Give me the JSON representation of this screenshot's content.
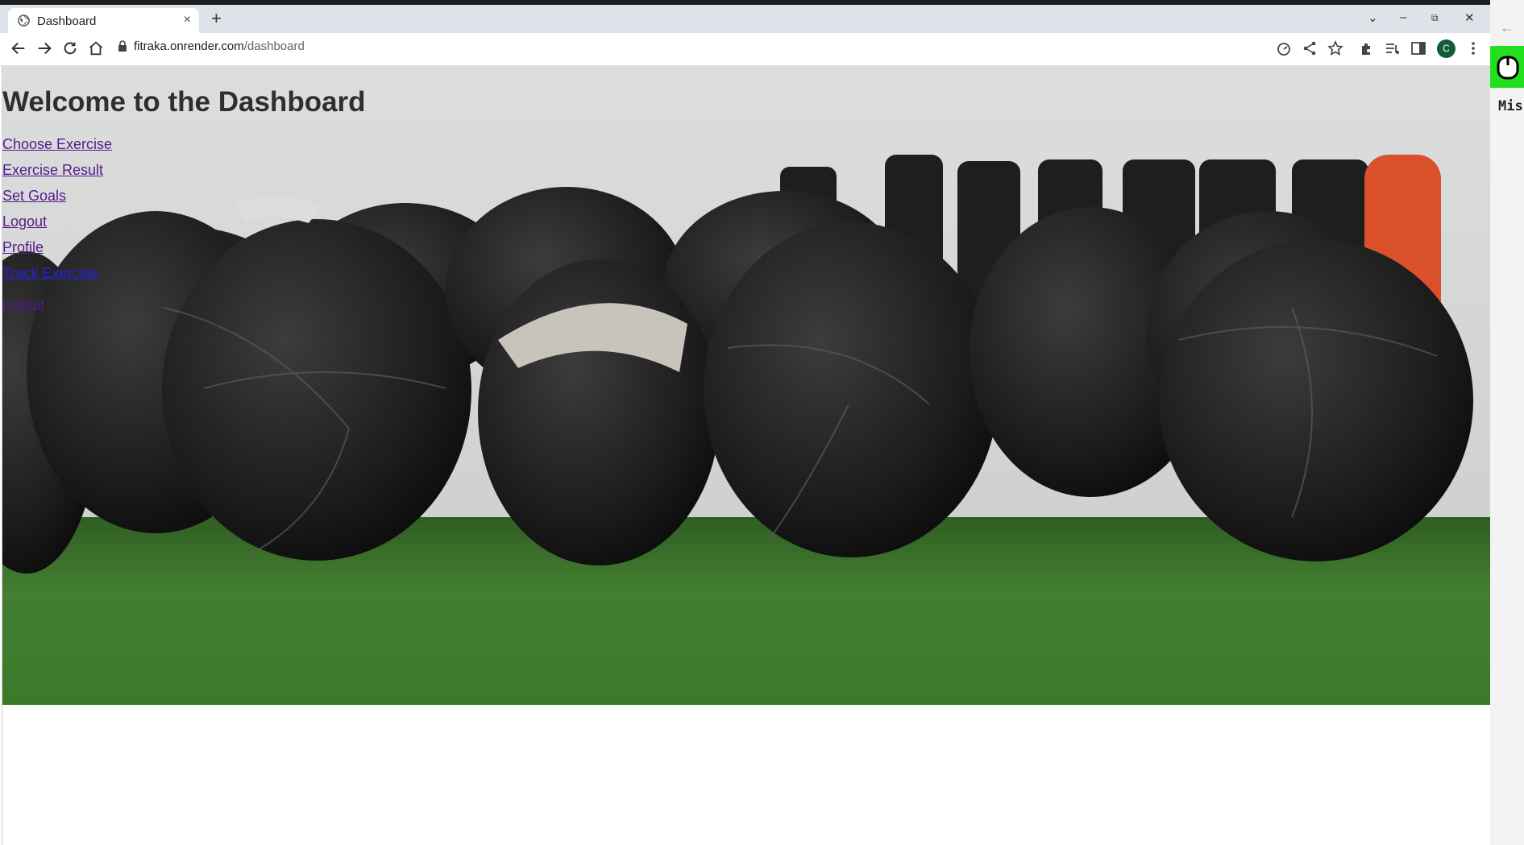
{
  "browser": {
    "tab_title": "Dashboard",
    "tab_close": "×",
    "new_tab": "+",
    "url_host": "fitraka.onrender.com",
    "url_path": "/dashboard",
    "profile_initial": "C",
    "window_controls": [
      "⌄",
      "–",
      "⧉",
      "✕"
    ]
  },
  "page": {
    "heading": "Welcome to the Dashboard",
    "links": [
      {
        "label": "Choose Exercise"
      },
      {
        "label": "Exercise Result"
      },
      {
        "label": "Set Goals"
      },
      {
        "label": "Logout"
      },
      {
        "label": "Profile"
      },
      {
        "label": "Track Exercise"
      },
      {
        "label": "Logout"
      }
    ]
  },
  "side_panel": {
    "back": "←",
    "text": "Mis"
  },
  "icons": [
    "globe-icon",
    "back-icon",
    "forward-icon",
    "reload-icon",
    "home-icon",
    "lock-icon",
    "cast-icon",
    "share-icon",
    "star-icon",
    "extensions-icon",
    "reading-list-icon",
    "side-panel-icon",
    "menu-icon"
  ],
  "colors": {
    "link": "#2a1fd8",
    "visited_link": "#551a8b",
    "heading": "#2f2f2f",
    "turf": "#3f7a2c",
    "wall": "#d6d8d8"
  }
}
